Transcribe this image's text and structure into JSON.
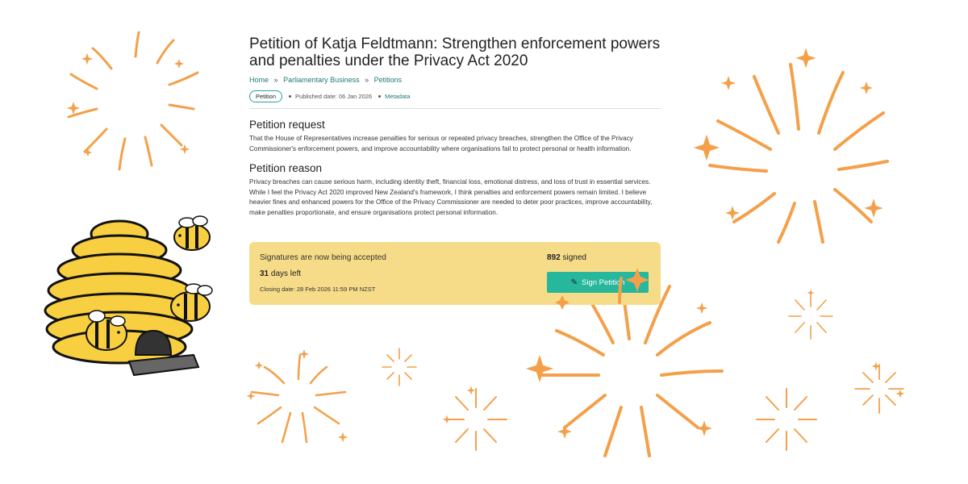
{
  "petition": {
    "title_line1": "Petition of Katja Feldtmann: Strengthen enforcement powers",
    "title_line2": "and penalties under the Privacy Act 2020",
    "breadcrumb": {
      "home": "Home",
      "parliamentary_business": "Parliamentary Business",
      "petitions": "Petitions",
      "separator": "»"
    },
    "badge": "Petition",
    "published_date": "Published date: 06 Jan 2026",
    "metadata_link": "Metadata",
    "request_heading": "Petition request",
    "request_text": "That the House of Representatives increase penalties for serious or repeated privacy breaches, strengthen the Office of the Privacy Commissioner's enforcement powers, and improve accountability where organisations fail to protect personal or health information.",
    "reason_heading": "Petition reason",
    "reason_text": "Privacy breaches can cause serious harm, including identity theft, financial loss, emotional distress, and loss of trust in essential services. While I feel the Privacy Act 2020 improved New Zealand's framework, I think penalties and enforcement powers remain limited. I believe heavier fines and enhanced powers for the Office of the Privacy Commissioner are needed to deter poor practices, improve accountability, make penalties proportionate, and ensure organisations protect personal information."
  },
  "signatures": {
    "status": "Signatures are now being accepted",
    "days_left_number": "31",
    "days_left_text": "days left",
    "closing_date": "Closing date: 28 Feb 2026 11:59 PM NZST",
    "signed_number": "892",
    "signed_text": "signed",
    "sign_button_label": "Sign Petition",
    "sign_button_icon": "pencil-icon"
  },
  "colors": {
    "panel": "#f6dc88",
    "button": "#26b79c",
    "link": "#207a7a",
    "firework": "#f4a04a",
    "hive": "#f8cf40"
  }
}
